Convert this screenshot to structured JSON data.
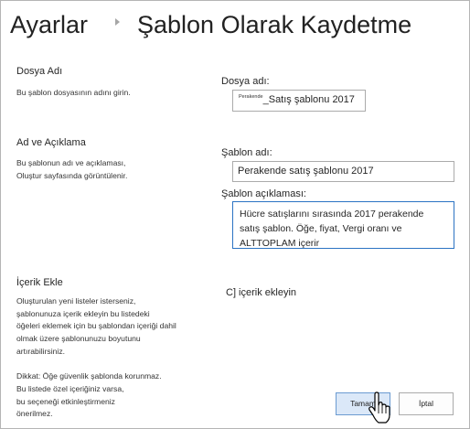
{
  "breadcrumb": {
    "root": "Ayarlar",
    "title": "Şablon Olarak Kaydetme"
  },
  "file_section": {
    "title": "Dosya Adı",
    "description": "Bu şablon dosyasının adını girin.",
    "field_label": "Dosya adı:",
    "field_prefix": "Perakende",
    "field_value": "_Satış şablonu 2017"
  },
  "name_section": {
    "title": "Ad ve Açıklama",
    "description": "Bu şablonun adı ve açıklaması,\nOluştur sayfasında görüntülenir.",
    "name_label": "Şablon adı:",
    "name_value": "Perakende satış şablonu 2017",
    "desc_label": "Şablon açıklaması:",
    "desc_value": "Hücre satışlarını sırasında 2017 perakende satış şablon. Öğe, fiyat, Vergi oranı ve ALTTOPLAM içerir"
  },
  "content_section": {
    "title": "İçerik Ekle",
    "description": "Oluşturulan yeni listeler isterseniz,\nşablonunuza içerik ekleyin bu listedeki\nöğeleri eklemek için bu şablondan içeriği dahil\nolmak üzere şablonunuzu boyutunu\nartırabilirsiniz.\n\nDikkat: Öğe güvenlik şablonda korunmaz.\nBu listede özel içeriğiniz varsa,\nbu seçeneği etkinleştirmeniz\nönerilmez.",
    "checkbox_label": "C] içerik ekleyin"
  },
  "buttons": {
    "ok": "Tamam",
    "cancel": "İptal"
  },
  "colors": {
    "focus_border": "#2b73c3",
    "primary_button": "#dbe8f8"
  }
}
